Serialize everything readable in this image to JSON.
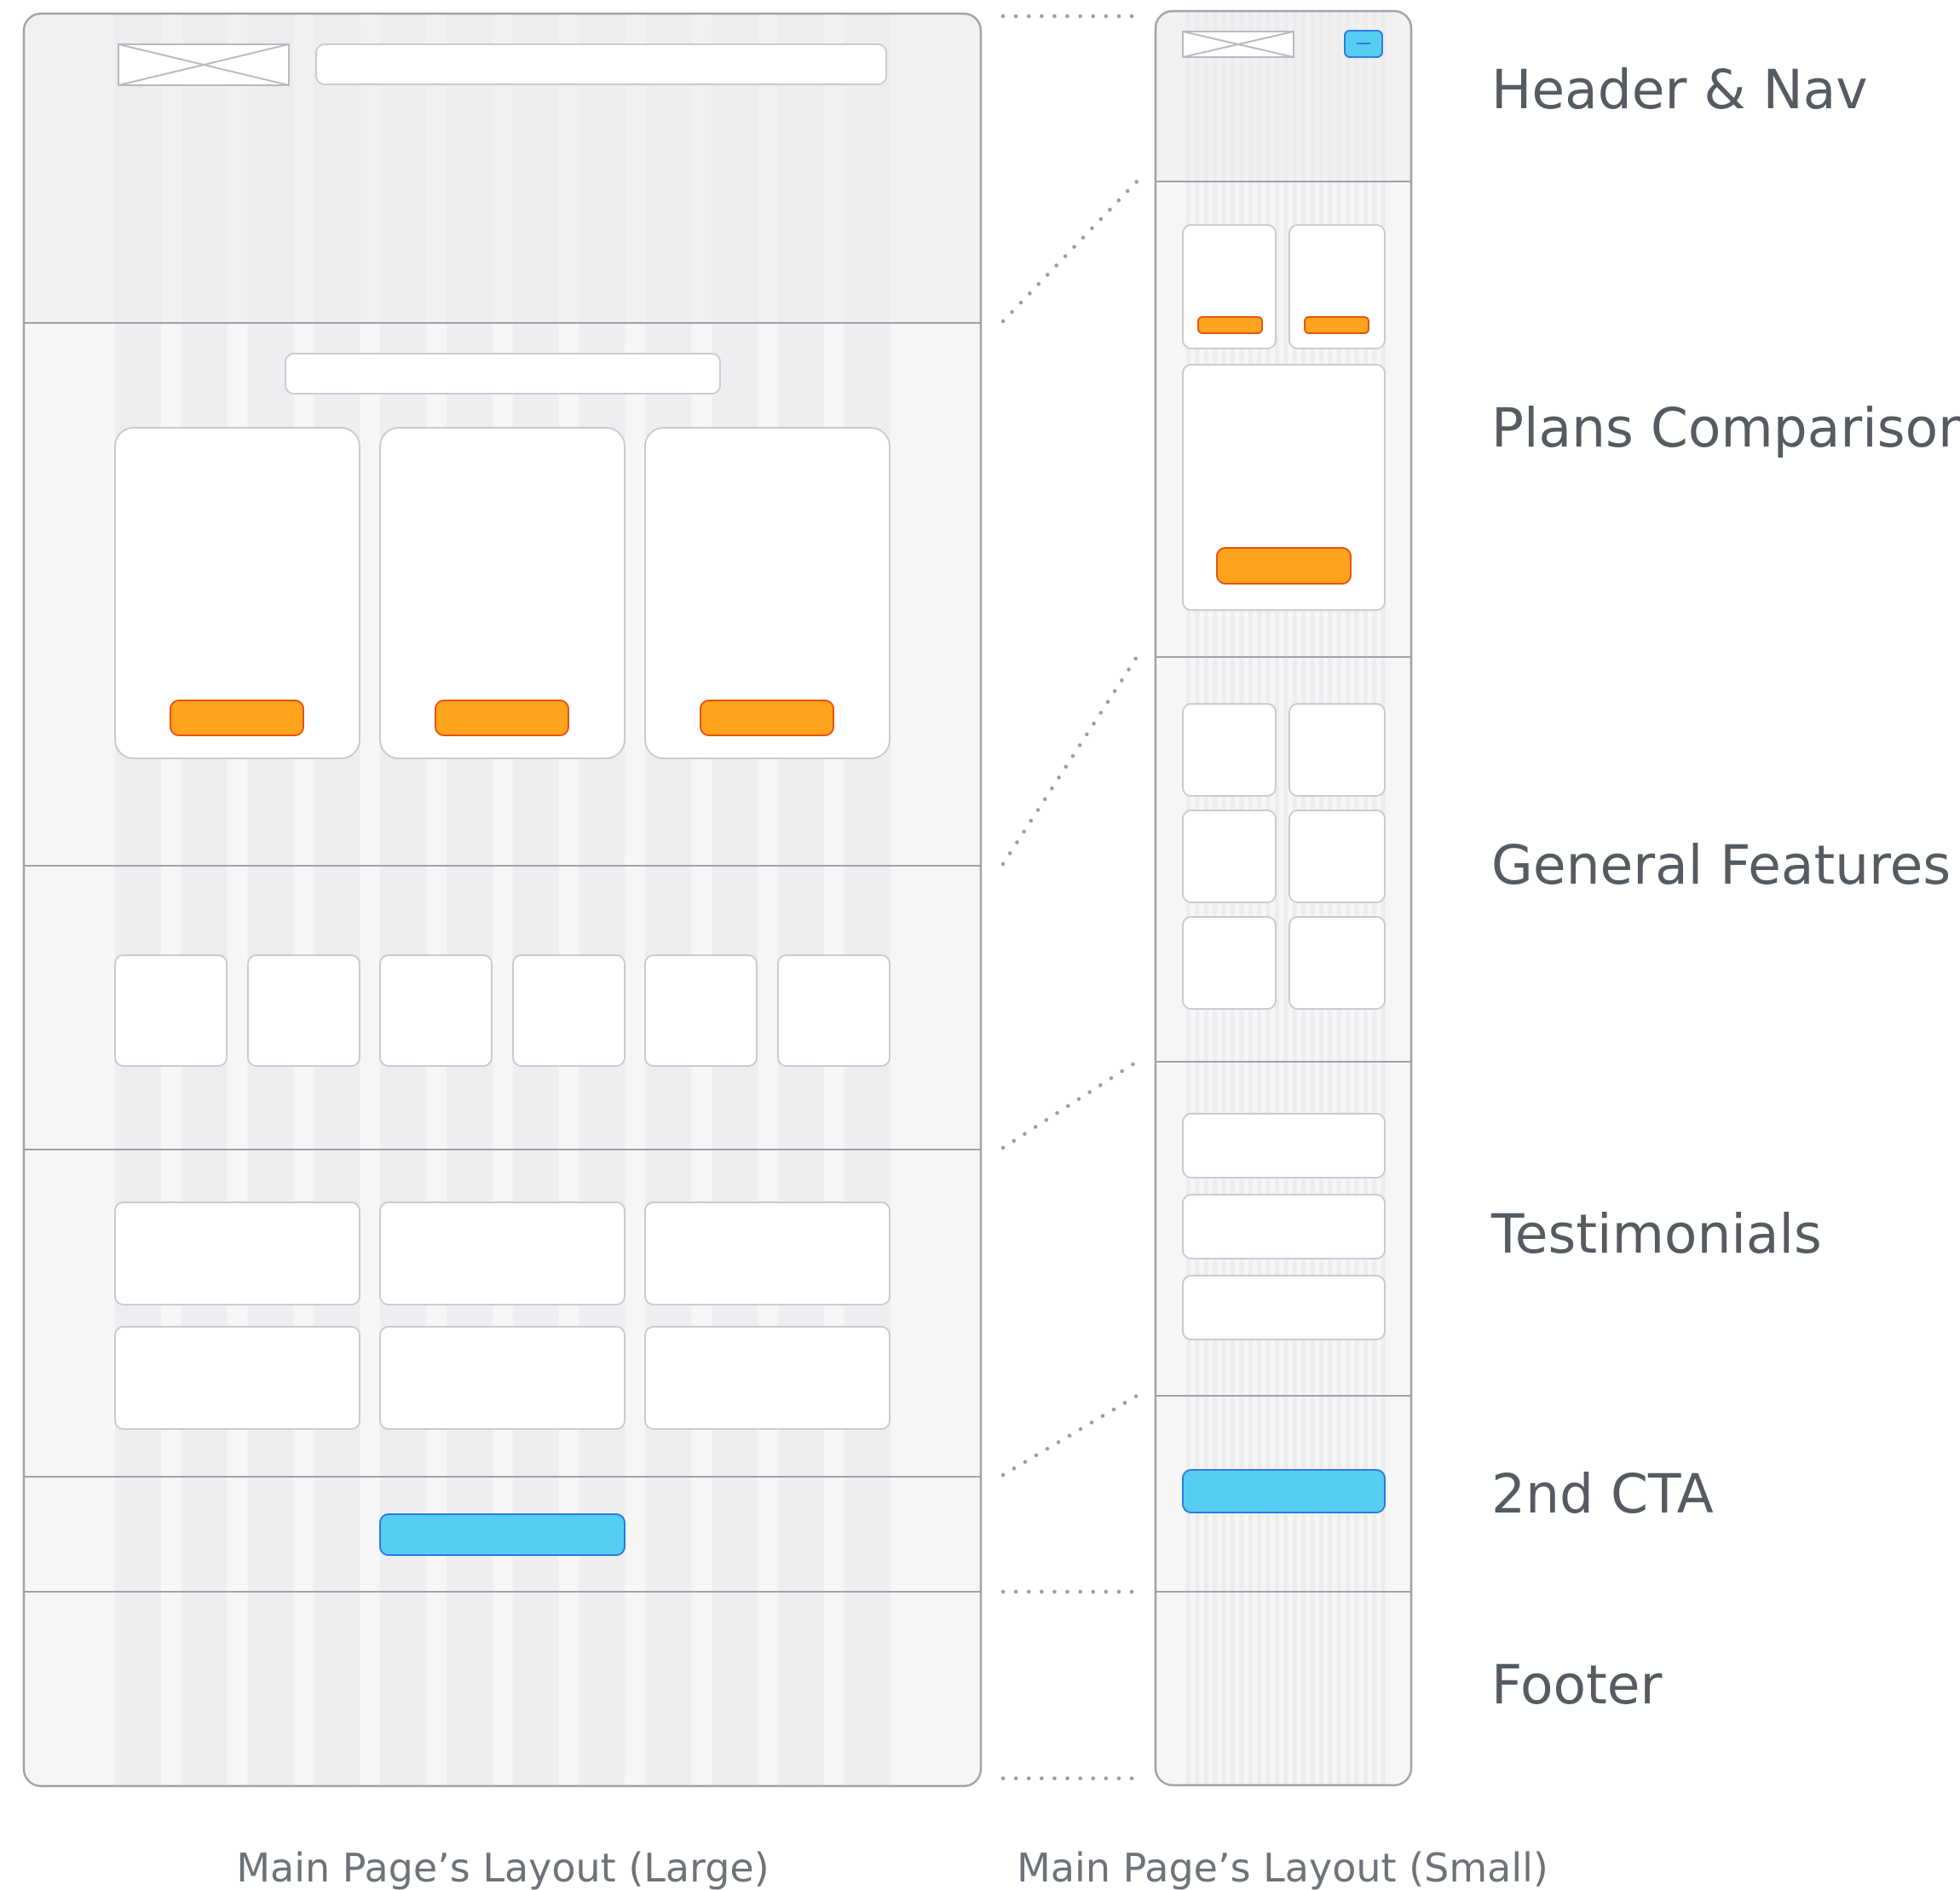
{
  "colors": {
    "frame_stroke": "#9fa3a9",
    "frame_fill": "#f6f6f7",
    "header_fill": "#f1f1f2",
    "column_stripe": "#ebebed",
    "card_fill": "#ffffff",
    "card_stroke": "#c9cbd1",
    "cta_primary": "#ffa41c",
    "cta_primary_stroke": "#e8530e",
    "cta_secondary": "#56cdf2",
    "cta_secondary_stroke": "#2c7be0",
    "connector": "#9a9ea4",
    "label_text": "#555b61",
    "caption_text": "#6e737a"
  },
  "sections": [
    {
      "id": "header-nav",
      "label": "Header & Nav"
    },
    {
      "id": "plans-comparison",
      "label": "Plans Comparison"
    },
    {
      "id": "general-features",
      "label": "General Features"
    },
    {
      "id": "testimonials",
      "label": "Testimonials"
    },
    {
      "id": "second-cta",
      "label": "2nd CTA"
    },
    {
      "id": "footer",
      "label": "Footer"
    }
  ],
  "captions": {
    "large": "Main Page’s Layout (Large)",
    "small": "Main Page’s Layout (Small)"
  },
  "icons": {
    "logo_placeholder": "image-placeholder-icon",
    "menu_button": "hamburger-menu-icon"
  }
}
